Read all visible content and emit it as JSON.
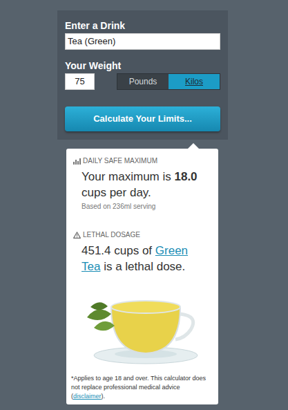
{
  "form": {
    "drink_label": "Enter a Drink",
    "drink_value": "Tea (Green)",
    "weight_label": "Your Weight",
    "weight_value": "75",
    "units": [
      {
        "label": "Pounds",
        "selected": false
      },
      {
        "label": "Kilos",
        "selected": true
      }
    ],
    "submit": "Calculate Your Limits..."
  },
  "result": {
    "daily": {
      "heading": "DAILY SAFE MAXIMUM",
      "text_before": "Your maximum is",
      "value": "18.0",
      "text_after": "cups per day.",
      "note": "Based on 236ml serving"
    },
    "lethal": {
      "heading": "LETHAL DOSAGE",
      "value": "451.4",
      "text_middle": "cups of",
      "drink_link": "Green Tea",
      "text_after": "is a lethal dose."
    },
    "footnote": {
      "text_before": "*Applies to age 18 and over. This calculator does not replace professional medical advice (",
      "link": "disclaimer",
      "text_after": ")."
    }
  }
}
